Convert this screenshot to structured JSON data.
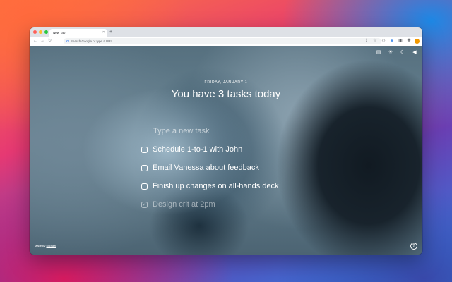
{
  "browser": {
    "tab_title": "New Tab",
    "tab_close": "×",
    "new_tab": "+",
    "omnibox_placeholder": "Search Google or type a URL",
    "nav": {
      "back": "←",
      "forward": "→",
      "reload": "↻"
    },
    "toolbar_icons": [
      "share-icon",
      "bookmark-icon",
      "shield-icon",
      "extension-v-icon",
      "extension-capture-icon",
      "puzzle-icon",
      "profile-avatar"
    ]
  },
  "content_icons": [
    "image-icon",
    "sun-icon",
    "moon-icon",
    "speaker-icon"
  ],
  "date": "FRIDAY, JANUARY 1",
  "headline": "You have 3 tasks today",
  "new_task_placeholder": "Type a new task",
  "tasks": [
    {
      "label": "Schedule 1-to-1 with John",
      "done": false
    },
    {
      "label": "Email Vanessa about feedback",
      "done": false
    },
    {
      "label": "Finish up changes on all-hands deck",
      "done": false
    },
    {
      "label": "Design crit at 2pm",
      "done": true
    }
  ],
  "credit": {
    "prefix": "Made by",
    "author": "Michael"
  },
  "info_label": "?",
  "colors": {
    "tab_strip": "#dee1e6",
    "toolbar": "#ffffff",
    "text": "#ffffff",
    "done_text": "rgba(255,255,255,0.5)"
  }
}
